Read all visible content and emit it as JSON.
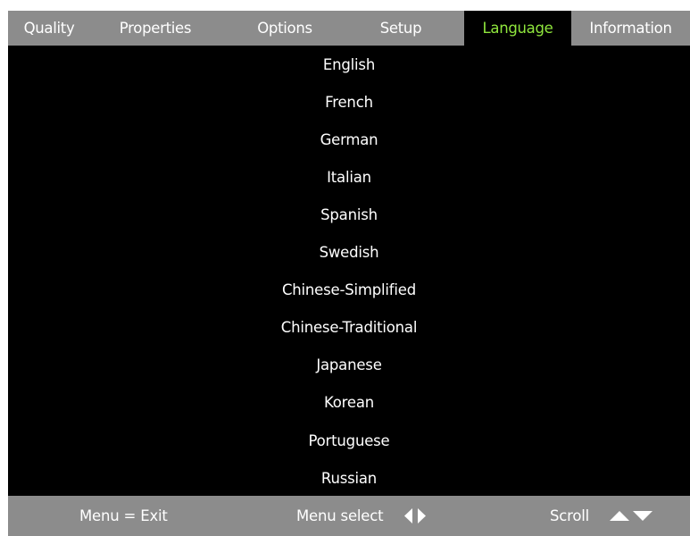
{
  "tabs": [
    {
      "label": "Quality",
      "active": false
    },
    {
      "label": "Properties",
      "active": false
    },
    {
      "label": "Options",
      "active": false
    },
    {
      "label": "Setup",
      "active": false
    },
    {
      "label": "Language",
      "active": true
    },
    {
      "label": "Information",
      "active": false
    }
  ],
  "languages": [
    "English",
    "French",
    "German",
    "Italian",
    "Spanish",
    "Swedish",
    "Chinese-Simplified",
    "Chinese-Traditional",
    "Japanese",
    "Korean",
    "Portuguese",
    "Russian"
  ],
  "footer": {
    "exit_hint": "Menu = Exit",
    "select_hint": "Menu select",
    "scroll_hint": "Scroll",
    "select_icon": "left-right-arrows-icon",
    "scroll_icon": "up-down-arrows-icon"
  },
  "colors": {
    "bar": "#8c8c8c",
    "background": "#000000",
    "text": "#ffffff",
    "active_tab_text": "#8fe63d"
  }
}
